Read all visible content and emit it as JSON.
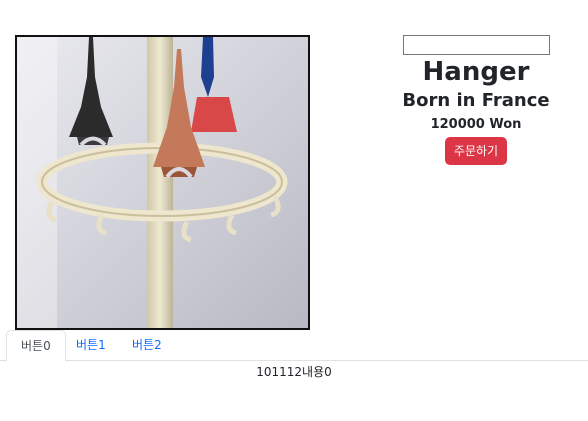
{
  "product": {
    "image_alt": "Hanger",
    "quantity_value": "",
    "title": "Hanger",
    "subtitle": "Born in France",
    "price": "120000 Won",
    "order_button_label": "주문하기"
  },
  "tabs": [
    {
      "label": "버튼0",
      "active": true
    },
    {
      "label": "버튼1",
      "active": false
    },
    {
      "label": "버튼2",
      "active": false
    }
  ],
  "tab_content": "101112내용0",
  "colors": {
    "order_button": "#dc3545",
    "tab_link": "#0d6efd"
  }
}
